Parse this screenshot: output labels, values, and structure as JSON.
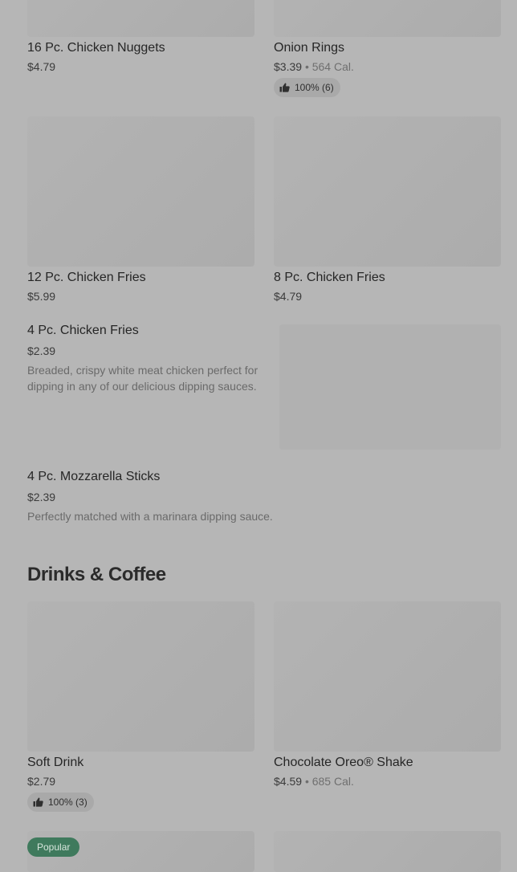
{
  "items": [
    {
      "name": "16 Pc. Chicken Nuggets",
      "price": "$4.79"
    },
    {
      "name": "Onion Rings",
      "price": "$3.39",
      "calories": "564 Cal.",
      "rating": "100% (6)"
    },
    {
      "name": "12 Pc. Chicken Fries",
      "price": "$5.99"
    },
    {
      "name": "8 Pc. Chicken Fries",
      "price": "$4.79"
    },
    {
      "name": "4 Pc. Chicken Fries",
      "price": "$2.39",
      "description": "Breaded, crispy white meat chicken perfect for dipping in any of our delicious dipping sauces."
    },
    {
      "name": "4 Pc. Mozzarella Sticks",
      "price": "$2.39",
      "description": "Perfectly matched with a marinara dipping sauce."
    }
  ],
  "section": {
    "title": "Drinks & Coffee"
  },
  "drinks": [
    {
      "name": "Soft Drink",
      "price": "$2.79",
      "rating": "100% (3)"
    },
    {
      "name": "Chocolate Oreo® Shake",
      "price": "$4.59",
      "calories": "685 Cal."
    }
  ],
  "badges": {
    "popular": "Popular"
  },
  "separator": "•",
  "colors": {
    "overlay": "#b6b6b6",
    "popular_badge": "#3f7a5d"
  }
}
